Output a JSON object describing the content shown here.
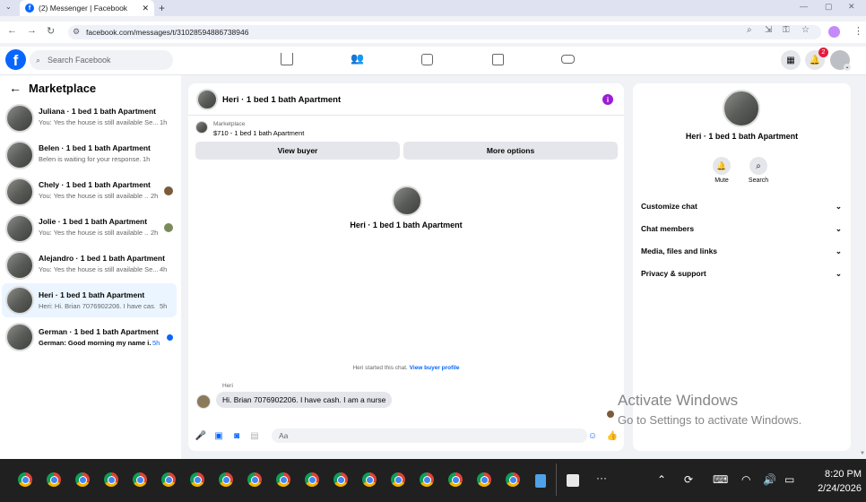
{
  "browser": {
    "tab_title": "(2) Messenger | Facebook",
    "url": "facebook.com/messages/t/31028594886738946"
  },
  "facebook": {
    "search_placeholder": "Search Facebook",
    "notification_count": "2"
  },
  "sidebar": {
    "title": "Marketplace",
    "conversations": [
      {
        "name": "Juliana · 1 bed 1 bath Apartment",
        "snippet": "You: Yes the house is still available Se...",
        "time": "1h"
      },
      {
        "name": "Belen · 1 bed 1 bath Apartment",
        "snippet": "Belen is waiting for your response.",
        "time": "1h"
      },
      {
        "name": "Chely · 1 bed 1 bath Apartment",
        "snippet": "You: Yes the house is still available ...",
        "time": "2h"
      },
      {
        "name": "Jolie · 1 bed 1 bath Apartment",
        "snippet": "You: Yes the house is still available ...",
        "time": "2h"
      },
      {
        "name": "Alejandro · 1 bed 1 bath Apartment",
        "snippet": "You: Yes the house is still available Se...",
        "time": "4h"
      },
      {
        "name": "Heri · 1 bed 1 bath Apartment",
        "snippet": "Heri: Hi. Brian 7076902206. I have cas...",
        "time": "5h"
      },
      {
        "name": "German · 1 bed 1 bath Apartment",
        "snippet": "German: Good morning my name i...",
        "time": "5h"
      }
    ]
  },
  "chat": {
    "title": "Heri · 1 bed 1 bath Apartment",
    "listing_label": "Marketplace",
    "listing_price": "$710 - 1 bed 1 bath Apartment",
    "view_buyer": "View buyer",
    "more_options": "More options",
    "profile_name": "Heri · 1 bed 1 bath Apartment",
    "started_text": "Heri started this chat.",
    "view_profile": "View buyer profile",
    "sender": "Heri",
    "message": "Hi. Brian 7076902206.  I have cash. I am a nurse",
    "composer_placeholder": "Aa"
  },
  "details": {
    "name": "Heri · 1 bed 1 bath Apartment",
    "mute": "Mute",
    "search": "Search",
    "items": [
      "Customize chat",
      "Chat members",
      "Media, files and links",
      "Privacy & support"
    ]
  },
  "watermark": {
    "title": "Activate Windows",
    "subtitle": "Go to Settings to activate Windows."
  },
  "taskbar": {
    "time": "8:20 PM",
    "date": "2/24/2026"
  }
}
